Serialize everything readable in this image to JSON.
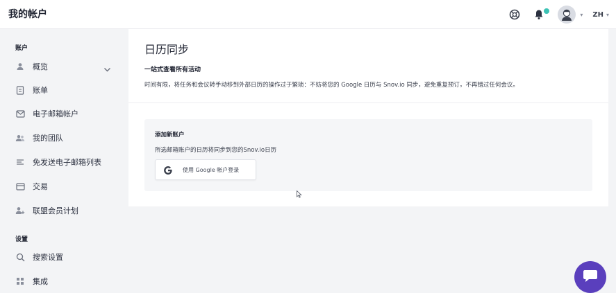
{
  "header": {
    "title": "我的帐户",
    "language": "ZH",
    "icons": [
      "help-icon",
      "bell-icon",
      "avatar",
      "chevron-down-icon"
    ],
    "notification_dot_color": "#3cc2b4"
  },
  "sidebar": {
    "account_section": "账户",
    "settings_section": "设置",
    "items": [
      {
        "label": "概览",
        "icon": "user-icon"
      },
      {
        "label": "账单",
        "icon": "invoice-icon"
      },
      {
        "label": "电子邮箱帐户",
        "icon": "mail-icon"
      },
      {
        "label": "我的团队",
        "icon": "team-icon"
      },
      {
        "label": "免发送电子邮箱列表",
        "icon": "list-icon"
      },
      {
        "label": "交易",
        "icon": "card-icon"
      },
      {
        "label": "联盟会员计划",
        "icon": "affiliate-icon"
      }
    ],
    "settings_items": [
      {
        "label": "搜索设置",
        "icon": "search-icon"
      },
      {
        "label": "集成",
        "icon": "grid-icon"
      }
    ]
  },
  "main": {
    "title": "日历同步",
    "subheading": "一站式查看所有活动",
    "description": "时间有限，将任务和会议转手动移到外部日历的操作过于繁琐：不妨将您的 Google 日历与 Snov.io 同步，避免重复预订，不再错过任何会议。",
    "panel": {
      "title": "添加新账户",
      "description": "所选邮箱账户的日历将同步到您的Snov.io日历",
      "google_button": "使用 Google 帐户登录"
    }
  },
  "chat": {
    "icon": "chat-icon",
    "color": "#5a3fbd"
  }
}
